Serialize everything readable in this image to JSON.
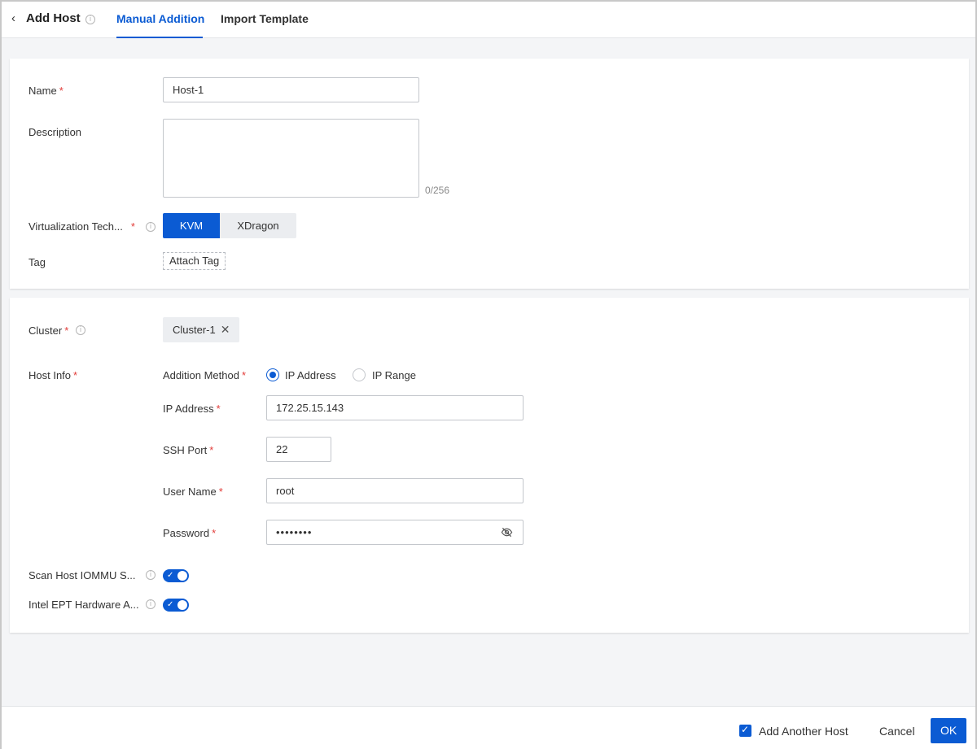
{
  "header": {
    "back_icon": "‹",
    "title": "Add Host",
    "tabs": [
      {
        "label": "Manual Addition",
        "active": true
      },
      {
        "label": "Import Template",
        "active": false
      }
    ]
  },
  "basic": {
    "name_label": "Name",
    "name_value": "Host-1",
    "description_label": "Description",
    "description_value": "",
    "description_counter": "0/256",
    "virt_label": "Virtualization Tech...",
    "virt_options": [
      "KVM",
      "XDragon"
    ],
    "virt_selected": "KVM",
    "tag_label": "Tag",
    "tag_button": "Attach Tag"
  },
  "connection": {
    "cluster_label": "Cluster",
    "cluster_value": "Cluster-1",
    "host_info_label": "Host Info",
    "method_label": "Addition Method",
    "method_options": [
      "IP Address",
      "IP Range"
    ],
    "method_selected": "IP Address",
    "ip_label": "IP Address",
    "ip_value": "172.25.15.143",
    "ssh_label": "SSH Port",
    "ssh_value": "22",
    "user_label": "User Name",
    "user_value": "root",
    "password_label": "Password",
    "password_value": "••••••••",
    "iommu_label": "Scan Host IOMMU S...",
    "iommu_on": true,
    "ept_label": "Intel EPT Hardware A...",
    "ept_on": true
  },
  "footer": {
    "add_another_label": "Add Another Host",
    "add_another_checked": true,
    "cancel_label": "Cancel",
    "ok_label": "OK"
  },
  "colors": {
    "accent": "#0b5bd3",
    "required": "#e23c39"
  }
}
